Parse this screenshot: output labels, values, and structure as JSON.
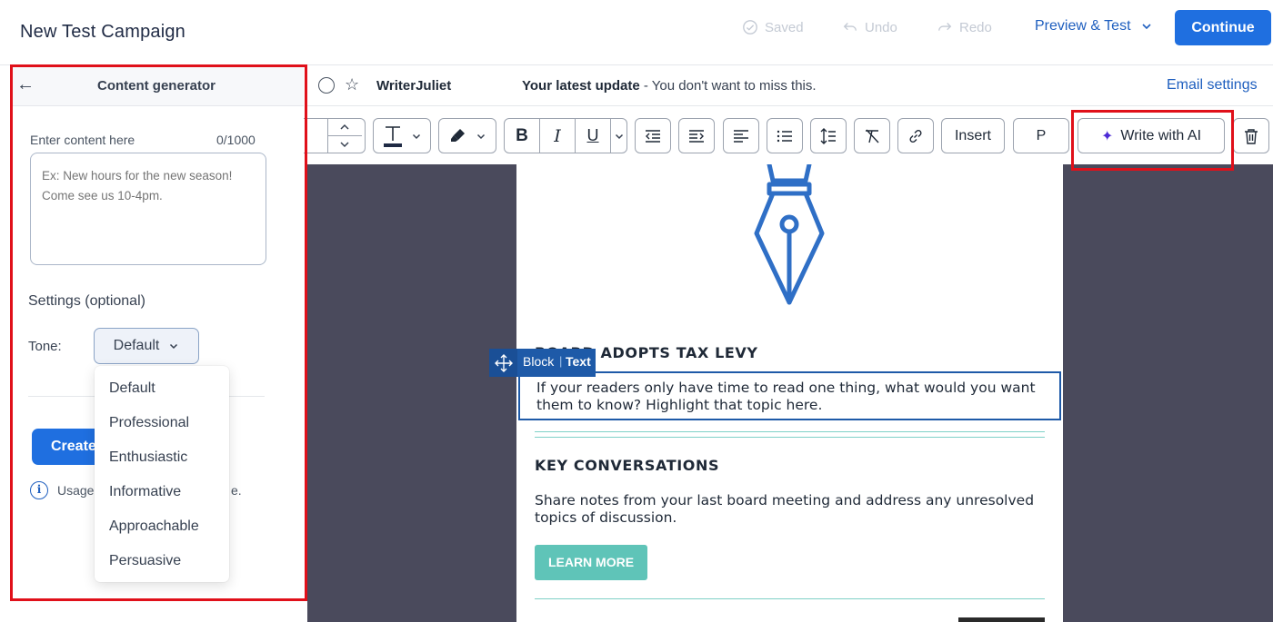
{
  "header": {
    "campaign_title": "New Test Campaign",
    "saved_label": "Saved",
    "undo_label": "Undo",
    "redo_label": "Redo",
    "preview_label": "Preview & Test",
    "continue_label": "Continue"
  },
  "left_panel": {
    "title": "Content generator",
    "input_label": "Enter content here",
    "char_count": "0/1000",
    "placeholder": "Ex: New hours for the new season!\nCome see us 10-4pm.",
    "settings_label": "Settings (optional)",
    "tone_label": "Tone:",
    "tone_value": "Default",
    "tone_options": [
      "Default",
      "Professional",
      "Enthusiastic",
      "Informative",
      "Approachable",
      "Persuasive"
    ],
    "create_label": "Create",
    "usage_text": "Usage",
    "usage_tail": "e."
  },
  "subject_bar": {
    "from_name": "WriterJuliet",
    "subject_bold": "Your latest update",
    "subject_rest": " - You don't want to miss this.",
    "settings_link": "Email settings"
  },
  "toolbar": {
    "insert_label": "Insert",
    "paragraph_label": "P",
    "ai_label": "Write with AI"
  },
  "email": {
    "heading_1": "BOARD ADOPTS TAX LEVY",
    "text_1": "If your readers only have time to read one thing, what would you want them to know? Highlight that topic here.",
    "heading_2": "KEY CONVERSATIONS",
    "text_2": "Share notes from your last board meeting and address any unresolved topics of discussion.",
    "button_label": "LEARN MORE",
    "block_tag_block": "Block",
    "block_tag_sep": "|",
    "block_tag_text": "Text"
  },
  "colors": {
    "primary_blue": "#1f6fe0",
    "link_blue": "#1f5fbf",
    "highlight_red": "#e0101a",
    "canvas_bg": "#4a4a5c",
    "teal_button": "#5fc4b8",
    "ai_purple": "#4c2bd6"
  }
}
